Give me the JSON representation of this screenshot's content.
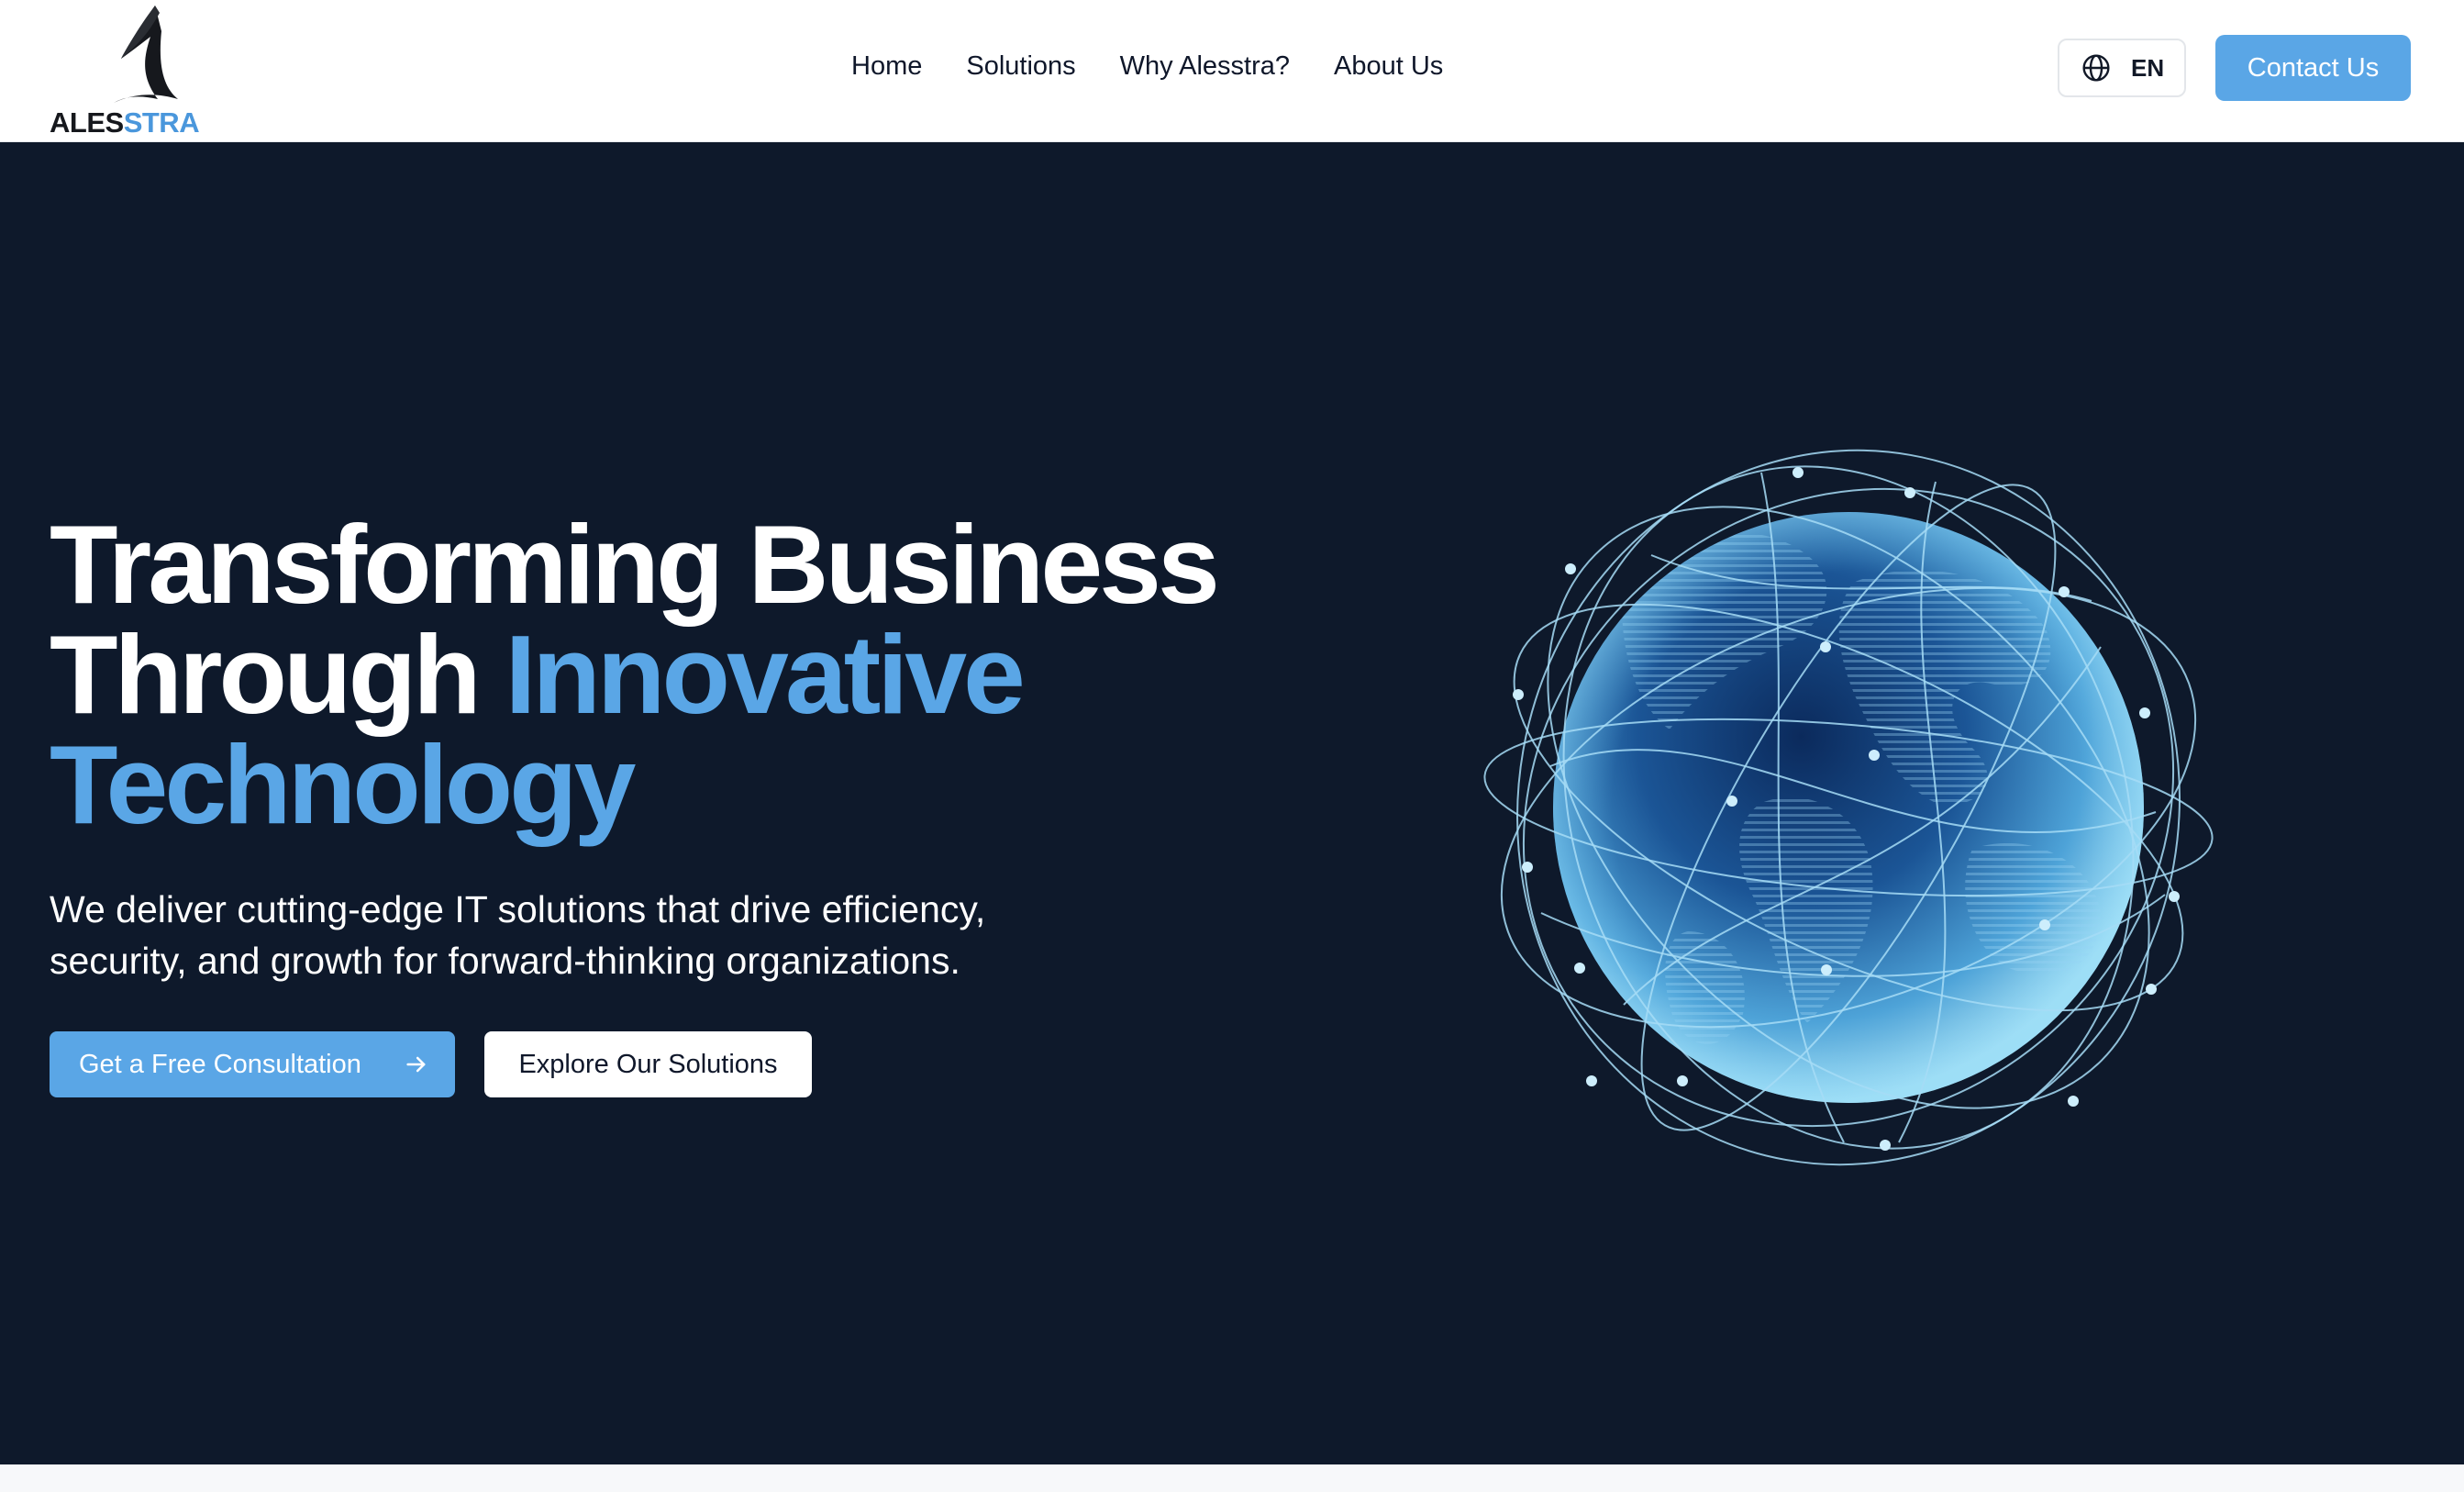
{
  "brand": {
    "logo_text_a": "ALES",
    "logo_text_b": "STRA"
  },
  "nav": {
    "items": [
      "Home",
      "Solutions",
      "Why Alesstra?",
      "About Us"
    ]
  },
  "language": {
    "icon": "globe-icon",
    "value": "EN"
  },
  "header": {
    "contact_label": "Contact Us"
  },
  "hero": {
    "headline_line1": "Transforming Business",
    "headline_line2_plain": "Through ",
    "headline_line2_accent": "Innovative",
    "headline_line3_accent": "Technology",
    "subtext": "We deliver cutting-edge IT solutions that drive efficiency, security, and growth for forward-thinking organizations.",
    "primary_cta": "Get a Free Consultation",
    "primary_cta_icon": "arrow-right-icon",
    "secondary_cta": "Explore Our Solutions",
    "image": "globe-network-illustration"
  },
  "colors": {
    "accent": "#5aa6e6",
    "hero_background": "#0e192b",
    "header_background": "#ffffff"
  }
}
